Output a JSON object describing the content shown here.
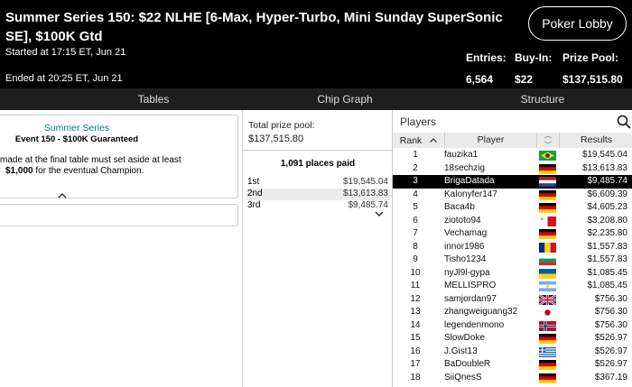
{
  "header": {
    "title": "Summer Series 150: $22 NLHE [6-Max, Hyper-Turbo, Mini Sunday SuperSonic SE], $100K Gtd",
    "started": "Started at 17:15 ET, Jun 21",
    "ended": "Ended at 20:25 ET, Jun 21",
    "lobby_label": "Poker Lobby",
    "stats": [
      {
        "label": "Entries:",
        "value": "6,564"
      },
      {
        "label": "Buy-In:",
        "value": "$22"
      },
      {
        "label": "Prize Pool:",
        "value": "$137,515.80"
      }
    ]
  },
  "tabs": [
    "Tables",
    "Chip Graph",
    "Structure"
  ],
  "info": {
    "series": "Summer Series",
    "event": "Event 150 - $100K Guaranteed",
    "rule_line1": "made at the final table must set aside at least",
    "rule_line2_bold": "$1,000",
    "rule_line2_rest": " for the eventual Champion.",
    "collapse_icon": "chevron-up-icon"
  },
  "prizes": {
    "total_label": "Total prize pool:",
    "total_value": "$137,515.80",
    "places_paid": "1,091 places paid",
    "payouts": [
      {
        "place": "1st",
        "amount": "$19,545.04"
      },
      {
        "place": "2nd",
        "amount": "$13,613.83"
      },
      {
        "place": "3rd",
        "amount": "$9,485.74"
      }
    ]
  },
  "players": {
    "title": "Players",
    "columns": {
      "rank": "Rank",
      "player": "Player",
      "results": "Results"
    },
    "rows": [
      {
        "rank": "1",
        "name": "fauzika1",
        "flag": "brazil",
        "result": "$19,545.04"
      },
      {
        "rank": "2",
        "name": "18sechzig",
        "flag": "germany",
        "result": "$13,613.83"
      },
      {
        "rank": "3",
        "name": "BrigaDatada",
        "flag": "netherlands",
        "result": "$9,485.74",
        "highlight": true
      },
      {
        "rank": "4",
        "name": "Kalonyfer147",
        "flag": "germany",
        "result": "$6,609.39"
      },
      {
        "rank": "5",
        "name": "Baca4b",
        "flag": "germany",
        "result": "$4,605.23"
      },
      {
        "rank": "6",
        "name": "ziototo94",
        "flag": "malta",
        "result": "$3,208.80"
      },
      {
        "rank": "7",
        "name": "Vechamag",
        "flag": "germany",
        "result": "$2,235.80"
      },
      {
        "rank": "8",
        "name": "innor1986",
        "flag": "romania",
        "result": "$1,557.83"
      },
      {
        "rank": "9",
        "name": "Tisho1234",
        "flag": "bulgaria",
        "result": "$1,557.83"
      },
      {
        "rank": "10",
        "name": "nyJl9l-gypa",
        "flag": "ukraine",
        "result": "$1,085.45"
      },
      {
        "rank": "11",
        "name": "MELLISPRO",
        "flag": "argentina",
        "result": "$1,085.45"
      },
      {
        "rank": "12",
        "name": "samjordan97",
        "flag": "uk",
        "result": "$756.30"
      },
      {
        "rank": "13",
        "name": "zhangweiguang32",
        "flag": "japan",
        "result": "$756.30"
      },
      {
        "rank": "14",
        "name": "legendenmono",
        "flag": "norway",
        "result": "$756.30"
      },
      {
        "rank": "15",
        "name": "SlowDoke",
        "flag": "germany",
        "result": "$526.97"
      },
      {
        "rank": "16",
        "name": "J.Gist13",
        "flag": "greece",
        "result": "$526.97"
      },
      {
        "rank": "17",
        "name": "BaDoubleR",
        "flag": "germany",
        "result": "$526.97"
      },
      {
        "rank": "18",
        "name": "SiiQnesS",
        "flag": "germany",
        "result": "$367.19"
      }
    ]
  }
}
